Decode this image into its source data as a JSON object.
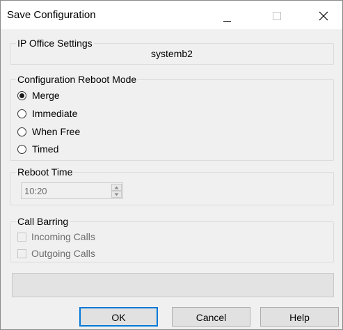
{
  "window": {
    "title": "Save Configuration"
  },
  "ip_office": {
    "legend": "IP Office Settings",
    "system_name": "systemb2"
  },
  "reboot_mode": {
    "legend": "Configuration Reboot Mode",
    "selected": "Merge",
    "options": [
      {
        "label": "Merge",
        "checked": true
      },
      {
        "label": "Immediate",
        "checked": false
      },
      {
        "label": "When Free",
        "checked": false
      },
      {
        "label": "Timed",
        "checked": false
      }
    ]
  },
  "reboot_time": {
    "legend": "Reboot Time",
    "value": "10:20",
    "enabled": false
  },
  "call_barring": {
    "legend": "Call Barring",
    "enabled": false,
    "options": [
      {
        "label": "Incoming Calls",
        "checked": false
      },
      {
        "label": "Outgoing Calls",
        "checked": false
      }
    ]
  },
  "buttons": {
    "ok": "OK",
    "cancel": "Cancel",
    "help": "Help"
  },
  "colors": {
    "dialog_bg": "#f0f0f0",
    "default_button_border": "#0078d7",
    "disabled_text": "#6d6d6d"
  }
}
